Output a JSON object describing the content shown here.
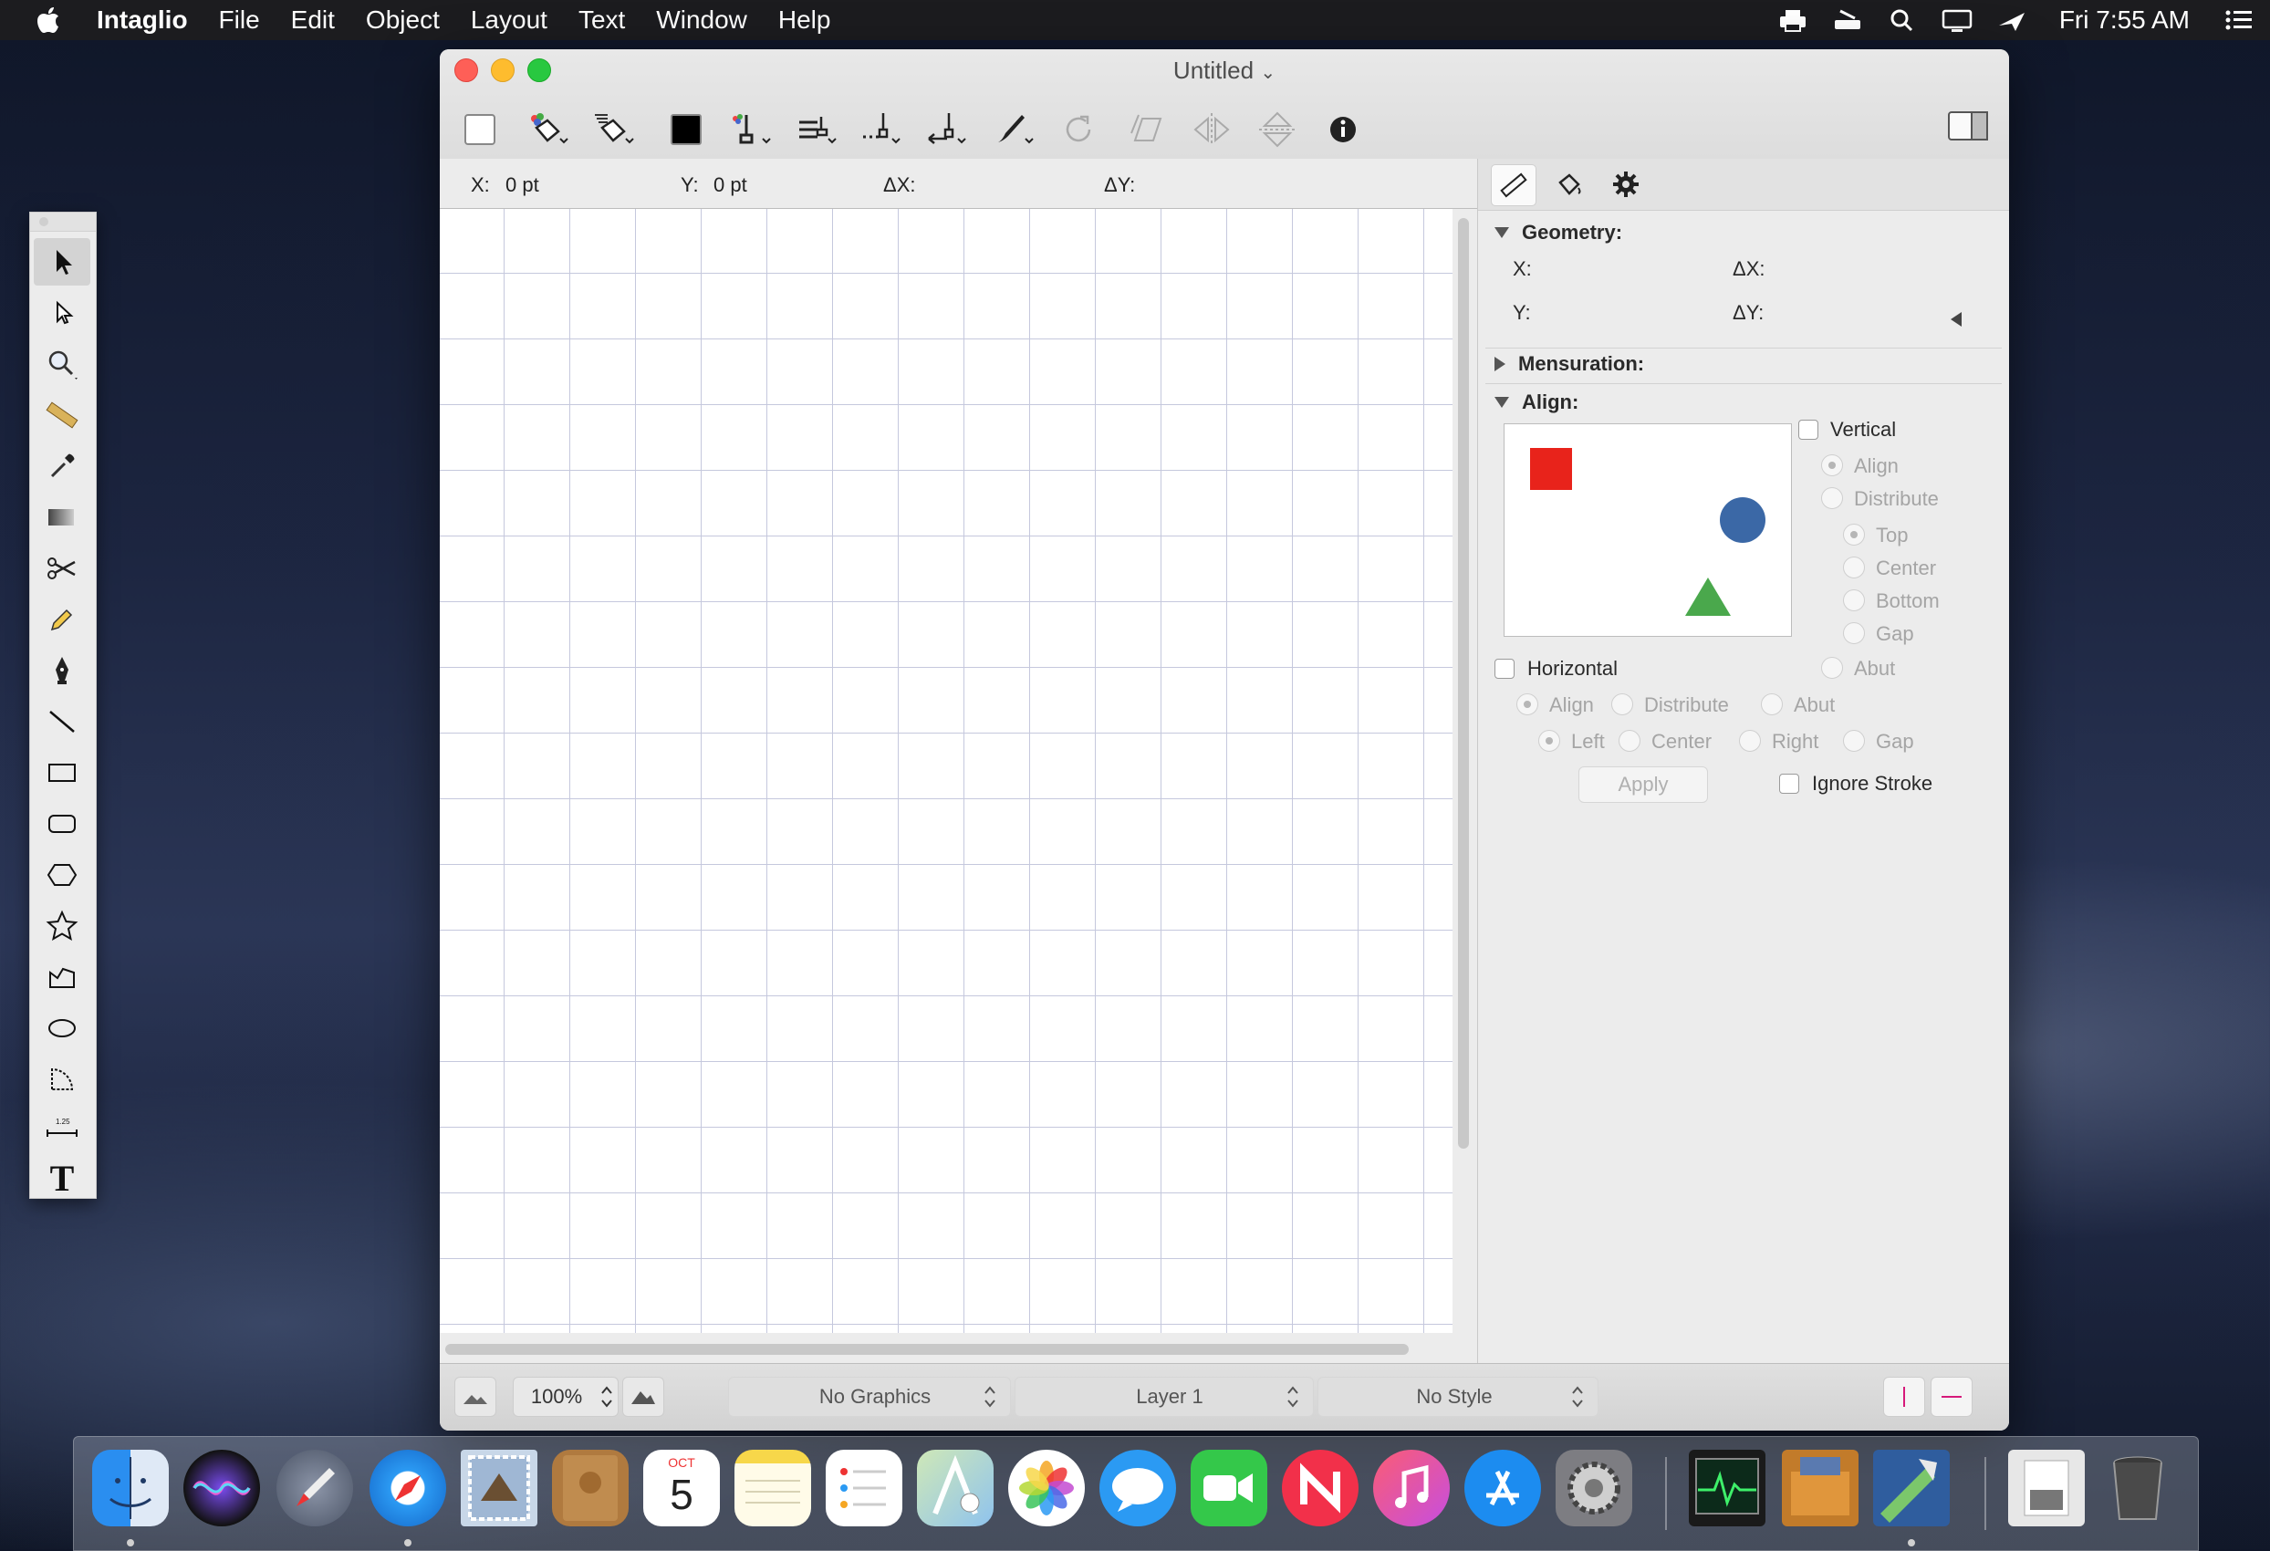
{
  "menubar": {
    "app_name": "Intaglio",
    "items": [
      "File",
      "Edit",
      "Object",
      "Layout",
      "Text",
      "Window",
      "Help"
    ],
    "clock": "Fri 7:55 AM",
    "status_icons": [
      "printer-icon",
      "scanner-icon",
      "spotlight-search-icon",
      "display-icon",
      "airplay-icon"
    ],
    "notification_icon": "notification-center-icon"
  },
  "tools": {
    "items": [
      "arrow-select-tool",
      "direct-select-tool",
      "zoom-tool",
      "ruler-tool",
      "eyedropper-tool",
      "gradient-tool",
      "scissors-tool",
      "pencil-tool",
      "pen-tool",
      "line-tool",
      "rectangle-tool",
      "rounded-rect-tool",
      "polygon-tool",
      "star-tool",
      "freeform-tool",
      "oval-tool",
      "arc-tool",
      "dimension-tool",
      "text-tool"
    ],
    "dimension_label": "1.25",
    "text_tool_glyph": "T"
  },
  "window": {
    "title": "Untitled",
    "title_chevron": "⌄"
  },
  "coords": {
    "x_label": "X:",
    "x_value": "0 pt",
    "y_label": "Y:",
    "y_value": "0 pt",
    "dx_label": "ΔX:",
    "dy_label": "ΔY:"
  },
  "inspector": {
    "geometry": {
      "title": "Geometry:",
      "x_label": "X:",
      "dx_label": "ΔX:",
      "y_label": "Y:",
      "dy_label": "ΔY:"
    },
    "mensuration": {
      "title": "Mensuration:"
    },
    "align": {
      "title": "Align:",
      "vertical_label": "Vertical",
      "vertical_align": "Align",
      "vertical_distribute": "Distribute",
      "top": "Top",
      "center": "Center",
      "bottom": "Bottom",
      "gap": "Gap",
      "abut": "Abut",
      "horizontal_label": "Horizontal",
      "h_align": "Align",
      "h_distribute": "Distribute",
      "h_abut": "Abut",
      "left": "Left",
      "h_center": "Center",
      "right": "Right",
      "h_gap": "Gap",
      "apply": "Apply",
      "ignore_stroke": "Ignore Stroke"
    }
  },
  "bottombar": {
    "zoom": "100%",
    "graphics": "No Graphics",
    "layer": "Layer 1",
    "style": "No Style"
  },
  "dock": {
    "apps": [
      "Finder",
      "Siri",
      "Launchpad",
      "Safari",
      "Mail",
      "Contacts",
      "Calendar",
      "Notes",
      "Reminders",
      "Maps",
      "Photos",
      "Messages",
      "FaceTime",
      "News",
      "iTunes",
      "App Store",
      "System Preferences",
      "Activity Monitor",
      "Archive Utility",
      "Intaglio",
      "Downloads",
      "Trash"
    ],
    "calendar_month": "OCT",
    "calendar_day": "5"
  },
  "colors": {
    "preview_square": "#e8231b",
    "preview_circle": "#3b68a6",
    "preview_triangle": "#4aa84c",
    "grid_line": "#c5c8dd"
  }
}
